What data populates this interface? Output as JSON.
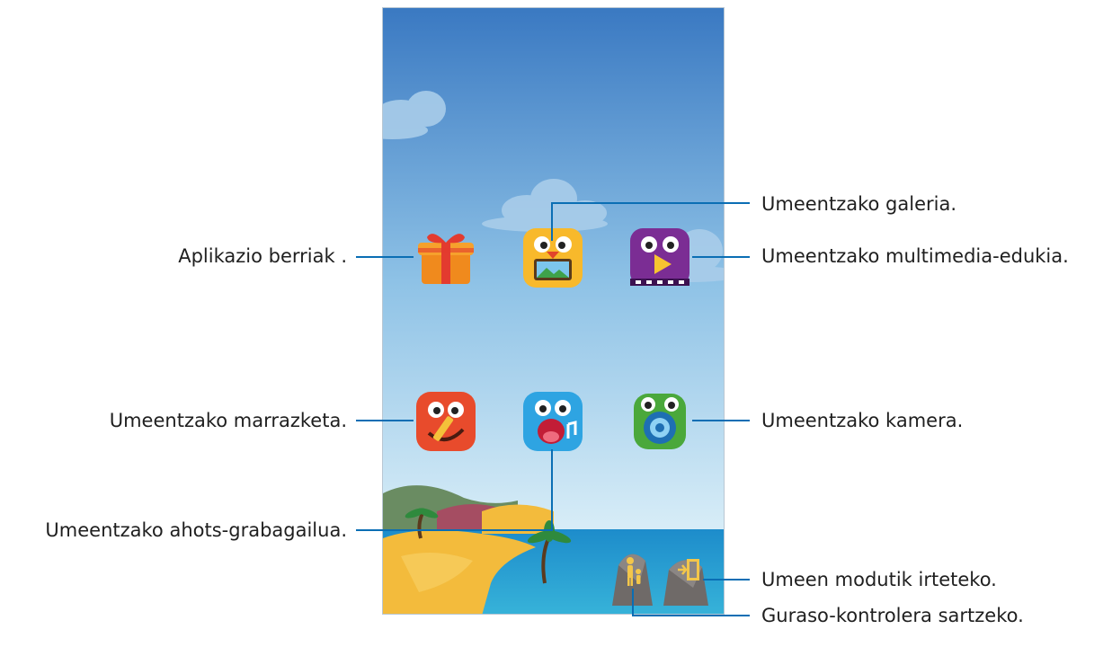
{
  "callouts": {
    "gallery": "Umeentzako galeria.",
    "new_apps": "Aplikazio berriak .",
    "media": "Umeentzako multimedia-edukia.",
    "drawing": "Umeentzako marrazketa.",
    "camera": "Umeentzako kamera.",
    "voice_recorder": "Umeentzako ahots-grabagailua.",
    "exit": "Umeen modutik irteteko.",
    "parental": "Guraso-kontrolera sartzeko."
  },
  "icons": {
    "new_apps": "gift-icon",
    "gallery": "gallery-monster-icon",
    "media": "video-monster-icon",
    "drawing": "drawing-monster-icon",
    "voice_recorder": "voice-recorder-monster-icon",
    "camera": "camera-monster-icon",
    "parental": "parent-child-rock-icon",
    "exit": "exit-door-rock-icon"
  },
  "colors": {
    "callout_line": "#0a6eb4",
    "sky_top": "#3f7fc6",
    "sky_bottom": "#cfe6f5",
    "sea": "#1b8fc8",
    "sand": "#f4c04a"
  }
}
